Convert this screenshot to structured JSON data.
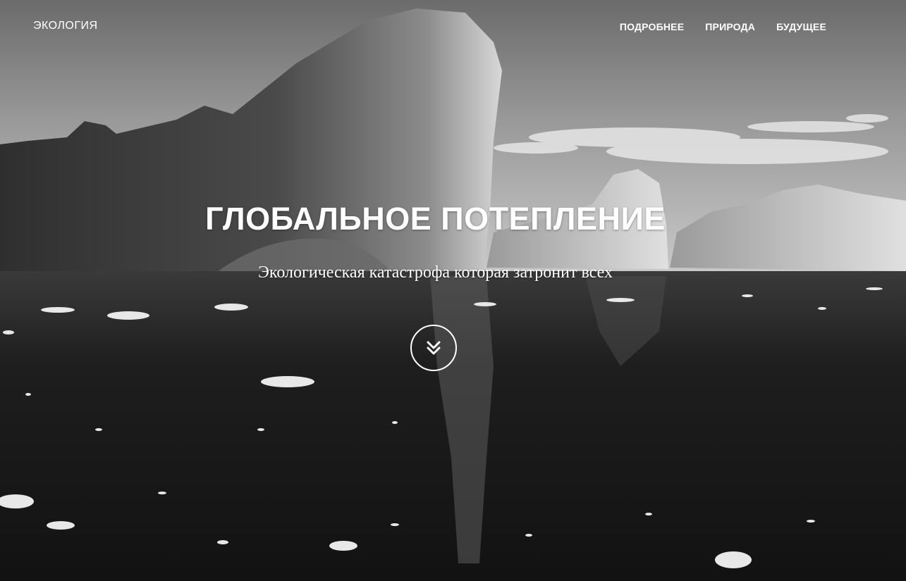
{
  "navbar": {
    "brand": "ЭКОЛОГИЯ",
    "links": [
      {
        "label": "ПОДРОБНЕЕ"
      },
      {
        "label": "ПРИРОДА"
      },
      {
        "label": "БУДУЩЕЕ"
      }
    ]
  },
  "hero": {
    "title": "ГЛОБАЛЬНОЕ ПОТЕПЛЕНИЕ",
    "subtitle": "Экологическая катастрофа которая затронит всех",
    "scroll_button": {
      "icon": "double-chevron-down-icon"
    },
    "background": {
      "description_icon": "iceberg-photo",
      "tone": "grayscale"
    }
  },
  "colors": {
    "text": "#ffffff"
  }
}
